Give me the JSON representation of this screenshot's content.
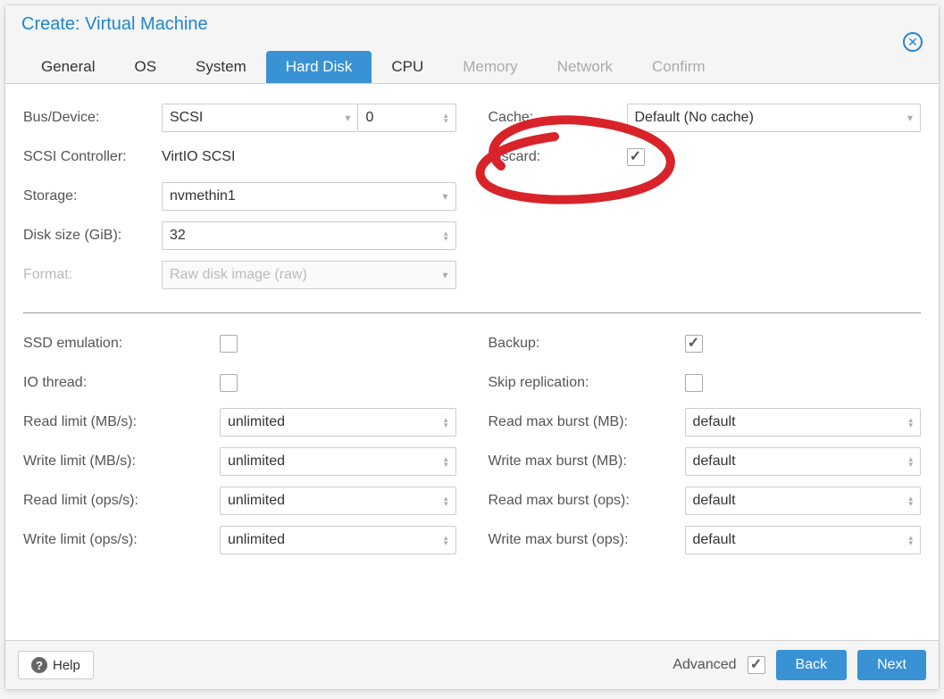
{
  "title": "Create: Virtual Machine",
  "tabs": [
    {
      "label": "General",
      "state": "normal"
    },
    {
      "label": "OS",
      "state": "normal"
    },
    {
      "label": "System",
      "state": "normal"
    },
    {
      "label": "Hard Disk",
      "state": "active"
    },
    {
      "label": "CPU",
      "state": "normal"
    },
    {
      "label": "Memory",
      "state": "disabled"
    },
    {
      "label": "Network",
      "state": "disabled"
    },
    {
      "label": "Confirm",
      "state": "disabled"
    }
  ],
  "left_top": {
    "bus_device_label": "Bus/Device:",
    "bus_value": "SCSI",
    "device_value": "0",
    "scsi_controller_label": "SCSI Controller:",
    "scsi_controller_value": "VirtIO SCSI",
    "storage_label": "Storage:",
    "storage_value": "nvmethin1",
    "disk_size_label": "Disk size (GiB):",
    "disk_size_value": "32",
    "format_label": "Format:",
    "format_value": "Raw disk image (raw)"
  },
  "right_top": {
    "cache_label": "Cache:",
    "cache_value": "Default (No cache)",
    "discard_label": "Discard:"
  },
  "left_bottom": {
    "ssd_emulation_label": "SSD emulation:",
    "io_thread_label": "IO thread:",
    "read_limit_mbs_label": "Read limit (MB/s):",
    "read_limit_mbs_value": "unlimited",
    "write_limit_mbs_label": "Write limit (MB/s):",
    "write_limit_mbs_value": "unlimited",
    "read_limit_ops_label": "Read limit (ops/s):",
    "read_limit_ops_value": "unlimited",
    "write_limit_ops_label": "Write limit (ops/s):",
    "write_limit_ops_value": "unlimited"
  },
  "right_bottom": {
    "backup_label": "Backup:",
    "skip_replication_label": "Skip replication:",
    "read_max_burst_mb_label": "Read max burst (MB):",
    "read_max_burst_mb_value": "default",
    "write_max_burst_mb_label": "Write max burst (MB):",
    "write_max_burst_mb_value": "default",
    "read_max_burst_ops_label": "Read max burst (ops):",
    "read_max_burst_ops_value": "default",
    "write_max_burst_ops_label": "Write max burst (ops):",
    "write_max_burst_ops_value": "default"
  },
  "checkboxes": {
    "discard": true,
    "ssd_emulation": false,
    "io_thread": false,
    "backup": true,
    "skip_replication": false,
    "advanced": true
  },
  "footer": {
    "help_label": "Help",
    "advanced_label": "Advanced",
    "back_label": "Back",
    "next_label": "Next"
  }
}
